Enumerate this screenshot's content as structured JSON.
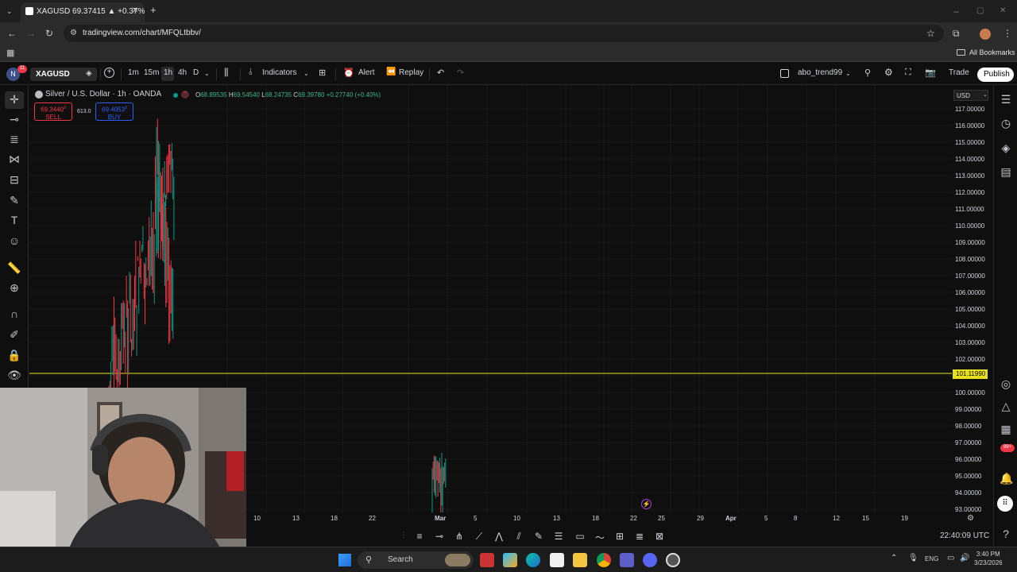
{
  "browser": {
    "tab_title": "XAGUSD 69.37415 ▲ +0.37% al",
    "url": "tradingview.com/chart/MFQLtbbv/",
    "bookmarks_label": "All Bookmarks"
  },
  "header": {
    "notification_count": "11",
    "symbol": "XAGUSD",
    "intervals": [
      "1m",
      "15m",
      "1h",
      "4h",
      "D"
    ],
    "active_interval": "1h",
    "indicators_label": "Indicators",
    "alert_label": "Alert",
    "replay_label": "Replay",
    "layout_name": "abo_trend99",
    "trade_label": "Trade",
    "publish_label": "Publish"
  },
  "legend": {
    "title": "Silver / U.S. Dollar · 1h · OANDA",
    "o_label": "O",
    "o_value": "68.89535",
    "h_label": "H",
    "h_value": "69.54540",
    "l_label": "L",
    "l_value": "68.24735",
    "c_label": "C",
    "c_value": "69.39780",
    "change": "+0.27740 (+0.40%)",
    "sell_price": "69.3440",
    "sell_sup": "0",
    "sell_label": "SELL",
    "spread": "613.0",
    "buy_price": "69.4053",
    "buy_sup": "9",
    "buy_label": "BUY"
  },
  "price_axis": {
    "currency": "USD",
    "labels": [
      "117.00000",
      "116.00000",
      "115.00000",
      "114.00000",
      "113.00000",
      "112.00000",
      "111.00000",
      "110.00000",
      "109.00000",
      "108.00000",
      "107.00000",
      "106.00000",
      "105.00000",
      "104.00000",
      "103.00000",
      "102.00000",
      "100.00000",
      "99.00000",
      "98.00000",
      "97.00000",
      "96.00000",
      "95.00000",
      "94.00000",
      "93.00000"
    ],
    "current_price": "101.11990"
  },
  "time_axis": {
    "labels": [
      "10",
      "13",
      "18",
      "22",
      "Mar",
      "5",
      "10",
      "13",
      "18",
      "22",
      "25",
      "29",
      "Apr",
      "5",
      "8",
      "12",
      "15",
      "19"
    ]
  },
  "utc_time": "22:40:09 UTC",
  "taskbar": {
    "search_label": "Search",
    "lang": "ENG",
    "time": "3:40 PM",
    "date": "3/23/2026",
    "badge": "99+"
  },
  "colors": {
    "up": "#089981",
    "down": "#f23645",
    "price_line": "#e7e01f",
    "accent": "#2962ff"
  }
}
